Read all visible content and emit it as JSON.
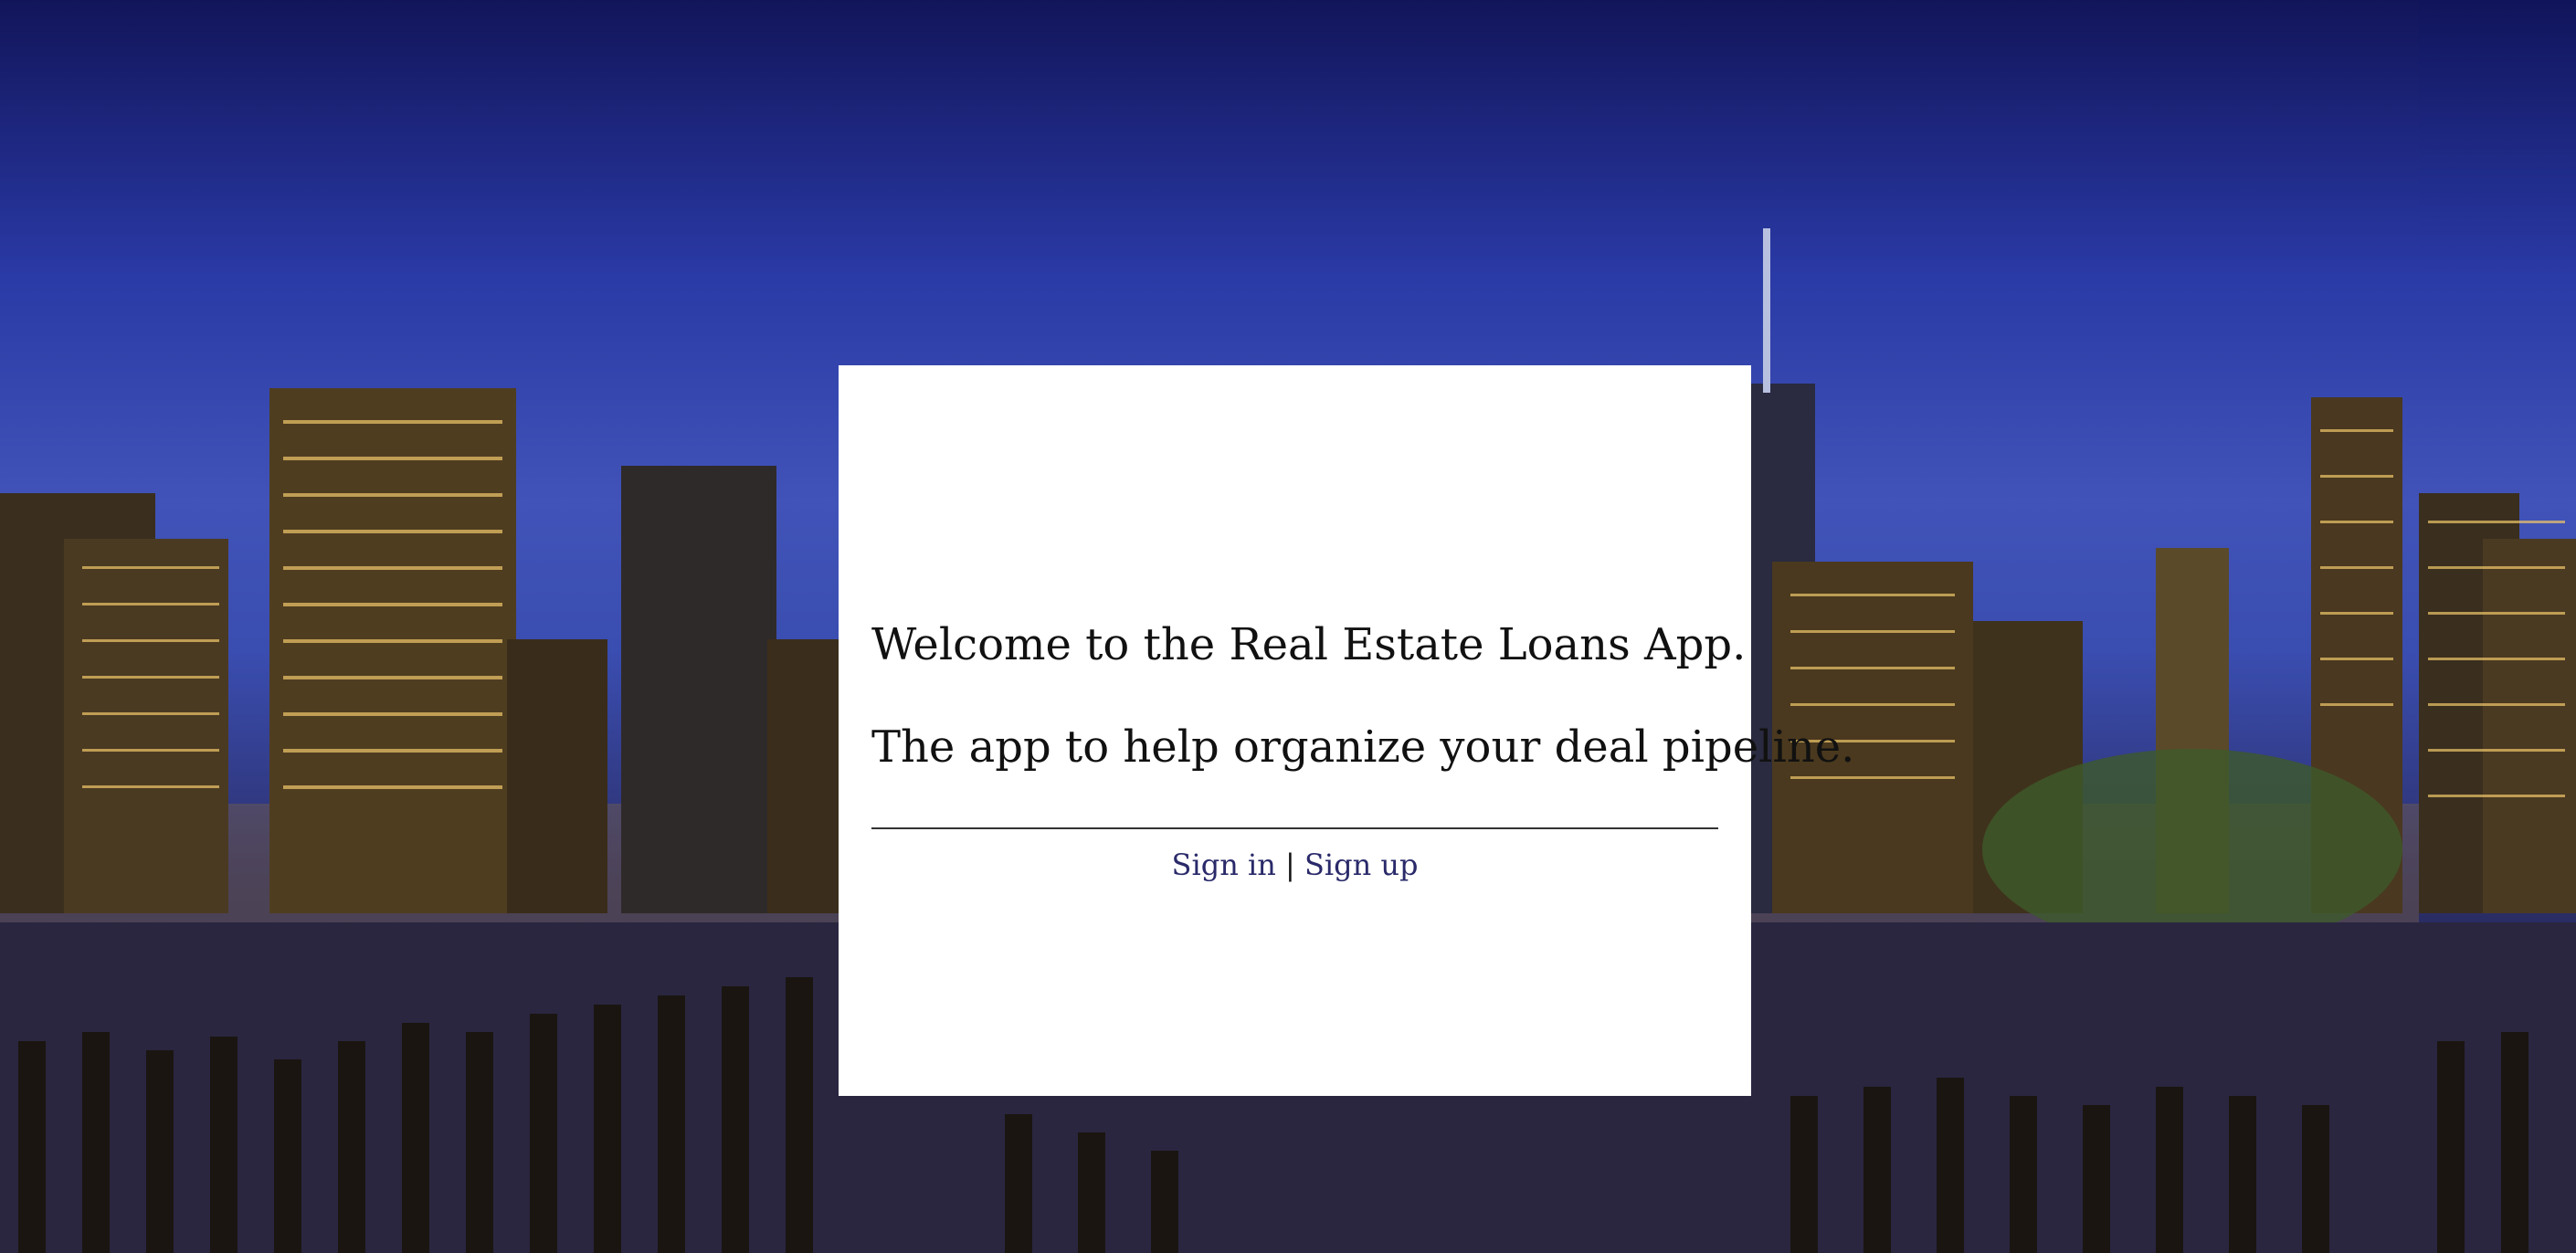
{
  "page": {
    "background_description_colors": {
      "sky_top": "#12155a",
      "sky_mid": "#4153b8",
      "water": "#1b1a34"
    }
  },
  "card": {
    "welcome_text": "Welcome to the Real Estate Loans App.",
    "tagline_text": "The app to help organize your deal pipeline.",
    "sign_in_label": "Sign in",
    "separator": "|",
    "sign_up_label": "Sign up"
  }
}
